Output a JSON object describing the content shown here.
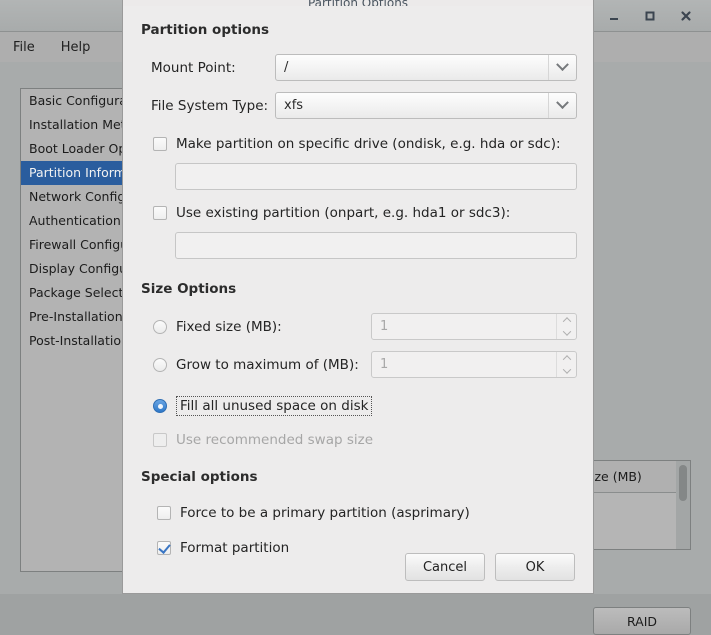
{
  "window": {
    "controls": {
      "minimize": "minimize-icon",
      "maximize": "maximize-icon",
      "close": "close-icon"
    },
    "menu": [
      {
        "label": "File"
      },
      {
        "label": "Help"
      }
    ]
  },
  "sidebar": {
    "items": [
      {
        "label": "Basic Configuration",
        "selected": false
      },
      {
        "label": "Installation Method",
        "selected": false
      },
      {
        "label": "Boot Loader Options",
        "selected": false
      },
      {
        "label": "Partition Information",
        "selected": true
      },
      {
        "label": "Network Configuration",
        "selected": false
      },
      {
        "label": "Authentication",
        "selected": false
      },
      {
        "label": "Firewall Configuration",
        "selected": false
      },
      {
        "label": "Display Configuration",
        "selected": false
      },
      {
        "label": "Package Selection",
        "selected": false
      },
      {
        "label": "Pre-Installation Script",
        "selected": false
      },
      {
        "label": "Post-Installation Script",
        "selected": false
      }
    ]
  },
  "background_panel": {
    "table_header": "ize (MB)",
    "raid_button": "RAID"
  },
  "dialog": {
    "title": "Partition Options",
    "sections": {
      "partition_options": {
        "title": "Partition options",
        "mount_point": {
          "label": "Mount Point:",
          "value": "/"
        },
        "file_system_type": {
          "label": "File System Type:",
          "value": "xfs"
        },
        "ondisk": {
          "label": "Make partition on specific drive (ondisk, e.g. hda or sdc):",
          "checked": false,
          "value": "",
          "placeholder": ""
        },
        "onpart": {
          "label": "Use existing partition (onpart, e.g. hda1 or sdc3):",
          "checked": false,
          "value": "",
          "placeholder": ""
        }
      },
      "size_options": {
        "title": "Size Options",
        "fixed_size": {
          "label": "Fixed size (MB):",
          "selected": false,
          "value": "1"
        },
        "grow_to_max": {
          "label": "Grow to maximum of (MB):",
          "selected": false,
          "value": "1"
        },
        "fill_all": {
          "label": "Fill all unused space on disk",
          "selected": true,
          "focused": true
        },
        "recommended_swap": {
          "label": "Use recommended swap size",
          "checked": false,
          "disabled": true
        }
      },
      "special_options": {
        "title": "Special options",
        "asprimary": {
          "label": "Force to be a primary partition (asprimary)",
          "checked": false
        },
        "format": {
          "label": "Format partition",
          "checked": true
        }
      }
    },
    "buttons": {
      "cancel": "Cancel",
      "ok": "OK"
    }
  },
  "colors": {
    "selection_blue": "#2a5d9e",
    "check_blue": "#3a76c4",
    "dialog_bg": "#edecec",
    "window_bg": "#a8abab",
    "titlebar": "#aeaeae"
  }
}
